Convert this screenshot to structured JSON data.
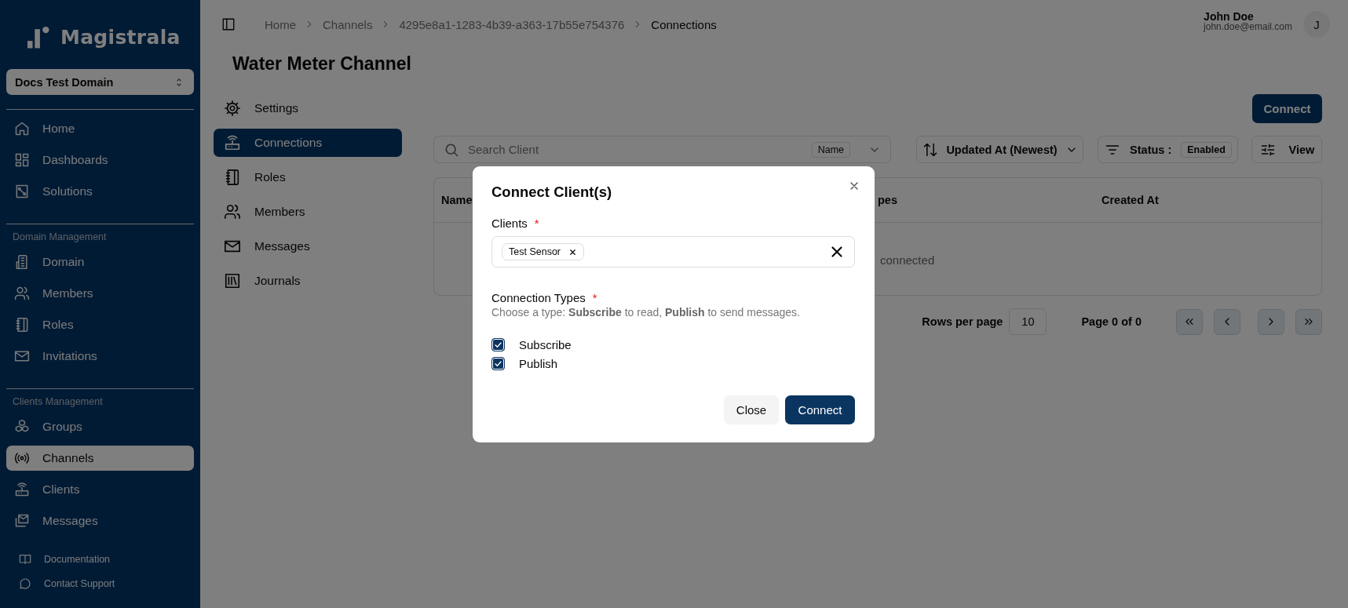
{
  "sidebar": {
    "logo": "Magistrala",
    "domain": "Docs Test Domain",
    "sections": [
      {
        "items": [
          {
            "label": "Home",
            "selected": false
          },
          {
            "label": "Dashboards",
            "selected": false
          },
          {
            "label": "Solutions",
            "selected": false
          }
        ]
      },
      {
        "heading": "Domain Management",
        "items": [
          {
            "label": "Domain",
            "selected": false
          },
          {
            "label": "Members",
            "selected": false
          },
          {
            "label": "Roles",
            "selected": false
          },
          {
            "label": "Invitations",
            "selected": false
          }
        ]
      },
      {
        "heading": "Clients Management",
        "items": [
          {
            "label": "Groups",
            "selected": false
          },
          {
            "label": "Channels",
            "selected": true
          },
          {
            "label": "Clients",
            "selected": false
          },
          {
            "label": "Messages",
            "selected": false
          }
        ]
      }
    ],
    "footer_links": [
      "Documentation",
      "Contact Support"
    ]
  },
  "topbar": {
    "breadcrumb": [
      {
        "label": "Home",
        "current": false
      },
      {
        "label": "Channels",
        "current": false
      },
      {
        "label": "4295e8a1-1283-4b39-a363-17b55e754376",
        "current": false
      },
      {
        "label": "Connections",
        "current": true
      }
    ],
    "user": {
      "name": "John Doe",
      "email": "john.doe@email.com",
      "avatar": "J"
    }
  },
  "page": {
    "title": "Water Meter Channel",
    "tabs": [
      {
        "label": "Settings",
        "selected": false
      },
      {
        "label": "Connections",
        "selected": true
      },
      {
        "label": "Roles",
        "selected": false
      },
      {
        "label": "Members",
        "selected": false
      },
      {
        "label": "Messages",
        "selected": false
      },
      {
        "label": "Journals",
        "selected": false
      }
    ],
    "connect_button": "Connect",
    "toolbar": {
      "search_placeholder": "Search Client",
      "search_filter": "Name",
      "sort": "Updated At (Newest)",
      "status_label": "Status :",
      "status_value": "Enabled",
      "view": "View"
    },
    "table": {
      "columns": [
        "Name",
        "pes",
        "Created At"
      ],
      "empty_message": "connected"
    },
    "pagination": {
      "rows_label": "Rows per page",
      "rows_value": "10",
      "page_info": "Page 0 of 0"
    }
  },
  "dialog": {
    "title": "Connect Client(s)",
    "clients": {
      "label": "Clients",
      "required": "*",
      "chips": [
        "Test Sensor"
      ]
    },
    "connection_types": {
      "label": "Connection Types",
      "required": "*",
      "hint": "Choose a type: **Subscribe** to read, **Publish** to send messages.",
      "options": [
        {
          "label": "Subscribe",
          "checked": true
        },
        {
          "label": "Publish",
          "checked": true
        }
      ]
    },
    "buttons": [
      {
        "label": "Close",
        "kind": "secondary"
      },
      {
        "label": "Connect",
        "kind": "primary"
      }
    ]
  }
}
